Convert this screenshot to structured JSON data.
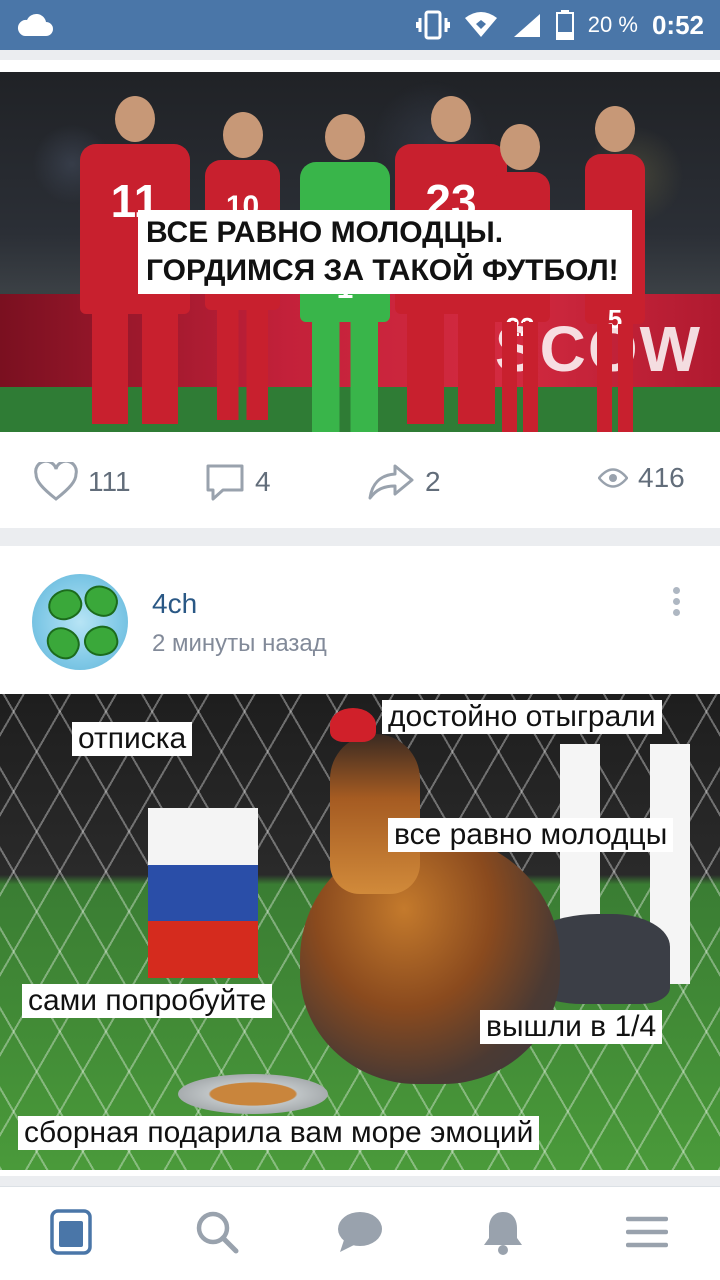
{
  "status_bar": {
    "battery_percent": "20 %",
    "time": "0:52",
    "icons": [
      "cloud-icon",
      "vibrate-icon",
      "wifi-icon",
      "signal-icon",
      "battery-icon"
    ]
  },
  "post1": {
    "image_caption_line1": "ВСЕ РАВНО МОЛОДЦЫ.",
    "image_caption_line2": "ГОРДИМСЯ ЗА ТАКОЙ ФУТБОЛ!",
    "jersey_numbers": [
      "11",
      "10",
      "1",
      "23",
      "22",
      "5"
    ],
    "stadium_banner": "SCOW",
    "likes": "111",
    "comments": "4",
    "shares": "2",
    "views": "416"
  },
  "post2": {
    "author": "4ch",
    "time_ago": "2 минуты назад",
    "meme_labels": {
      "a": "отписка",
      "b": "достойно отыграли",
      "c": "все равно молодцы",
      "d": "сами попробуйте",
      "e": "вышли в 1/4",
      "f": "сборная подарила вам море эмоций"
    }
  },
  "tabbar": {
    "active": "news",
    "tabs": [
      "news-icon",
      "search-icon",
      "messages-icon",
      "notifications-icon",
      "menu-icon"
    ]
  },
  "colors": {
    "header": "#4a76a8",
    "accent": "#4a76a8",
    "icon_gray": "#99a2ad",
    "text_secondary": "#828a99",
    "link": "#2a5885"
  }
}
